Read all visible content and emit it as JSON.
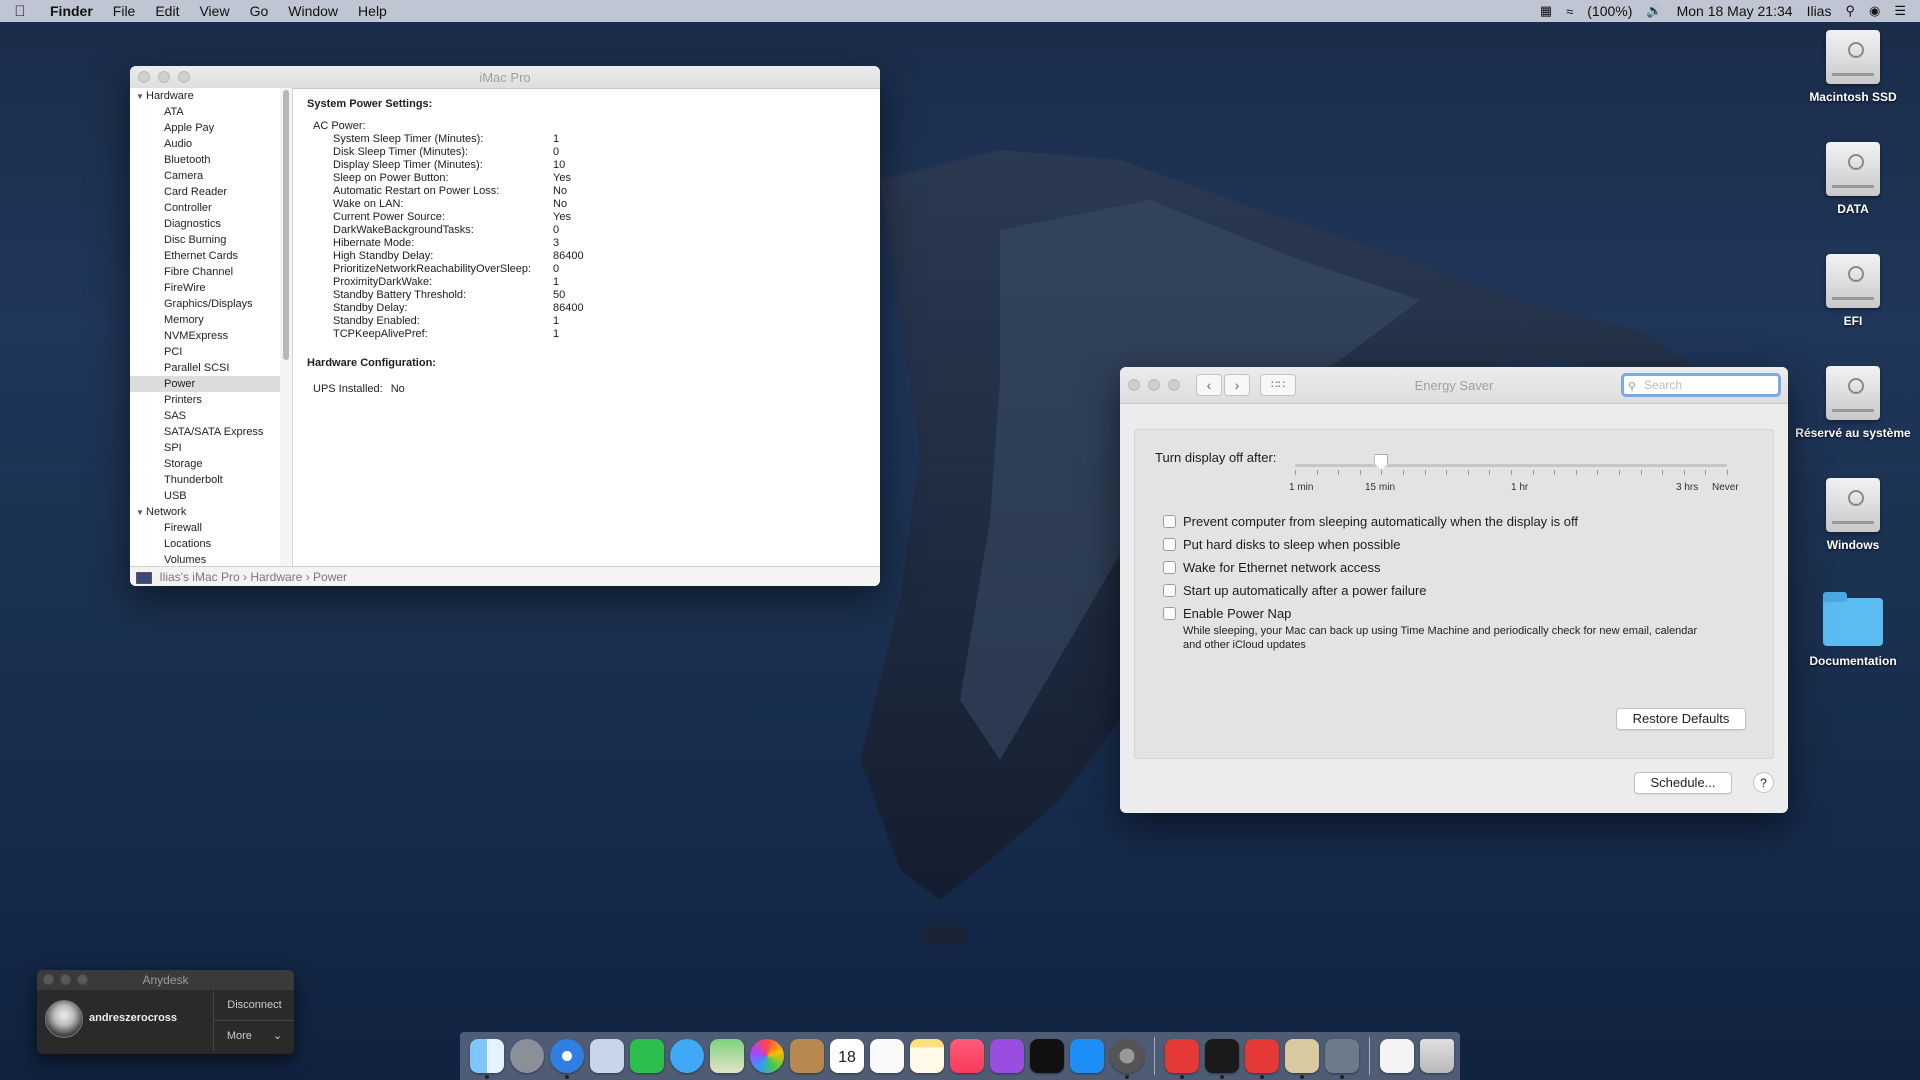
{
  "menubar": {
    "app": "Finder",
    "items": [
      "File",
      "Edit",
      "View",
      "Go",
      "Window",
      "Help"
    ],
    "battery": "(100%)",
    "datetime": "Mon 18 May  21:34",
    "user": "Ilias"
  },
  "sysinfo": {
    "title": "iMac Pro",
    "groups": [
      {
        "label": "Hardware",
        "items": [
          "ATA",
          "Apple Pay",
          "Audio",
          "Bluetooth",
          "Camera",
          "Card Reader",
          "Controller",
          "Diagnostics",
          "Disc Burning",
          "Ethernet Cards",
          "Fibre Channel",
          "FireWire",
          "Graphics/Displays",
          "Memory",
          "NVMExpress",
          "PCI",
          "Parallel SCSI",
          "Power",
          "Printers",
          "SAS",
          "SATA/SATA Express",
          "SPI",
          "Storage",
          "Thunderbolt",
          "USB"
        ]
      },
      {
        "label": "Network",
        "items": [
          "Firewall",
          "Locations",
          "Volumes"
        ]
      }
    ],
    "selected": "Power",
    "heading": "System Power Settings:",
    "ac_label": "AC Power:",
    "settings": [
      [
        "System Sleep Timer (Minutes):",
        "1"
      ],
      [
        "Disk Sleep Timer (Minutes):",
        "0"
      ],
      [
        "Display Sleep Timer (Minutes):",
        "10"
      ],
      [
        "Sleep on Power Button:",
        "Yes"
      ],
      [
        "Automatic Restart on Power Loss:",
        "No"
      ],
      [
        "Wake on LAN:",
        "No"
      ],
      [
        "Current Power Source:",
        "Yes"
      ],
      [
        "DarkWakeBackgroundTasks:",
        "0"
      ],
      [
        "Hibernate Mode:",
        "3"
      ],
      [
        "High Standby Delay:",
        "86400"
      ],
      [
        "PrioritizeNetworkReachabilityOverSleep:",
        "0"
      ],
      [
        "ProximityDarkWake:",
        "1"
      ],
      [
        "Standby Battery Threshold:",
        "50"
      ],
      [
        "Standby Delay:",
        "86400"
      ],
      [
        "Standby Enabled:",
        "1"
      ],
      [
        "TCPKeepAlivePref:",
        "1"
      ]
    ],
    "hw_heading": "Hardware Configuration:",
    "ups_label": "UPS Installed:",
    "ups_value": "No",
    "path": [
      "Ilias's iMac Pro",
      "Hardware",
      "Power"
    ]
  },
  "energy": {
    "title": "Energy Saver",
    "search_placeholder": "Search",
    "slider_label": "Turn display off after:",
    "slider_fraction": 0.2,
    "tick_labels": [
      "1 min",
      "15 min",
      "1 hr",
      "3 hrs",
      "Never"
    ],
    "options": [
      {
        "label": "Prevent computer from sleeping automatically when the display is off",
        "checked": false
      },
      {
        "label": "Put hard disks to sleep when possible",
        "checked": false
      },
      {
        "label": "Wake for Ethernet network access",
        "checked": false
      },
      {
        "label": "Start up automatically after a power failure",
        "checked": false
      },
      {
        "label": "Enable Power Nap",
        "checked": false
      }
    ],
    "power_nap_desc": "While sleeping, your Mac can back up using Time Machine and periodically check for new email, calendar and other iCloud updates",
    "restore_label": "Restore Defaults",
    "schedule_label": "Schedule...",
    "help_label": "?"
  },
  "desktop_icons": [
    "Macintosh SSD",
    "DATA",
    "EFI",
    "Réservé au système",
    "Windows",
    "Documentation"
  ],
  "anydesk": {
    "title": "Anydesk",
    "user": "andreszerocross",
    "disconnect": "Disconnect",
    "more": "More"
  },
  "dock": {
    "items": [
      "finder-icon",
      "launchpad-icon",
      "safari-icon",
      "preview-icon",
      "facetime-icon",
      "messages-icon",
      "maps-icon",
      "photos-icon",
      "contacts-icon",
      "calendar-icon",
      "reminders-icon",
      "notes-icon",
      "music-icon",
      "podcasts-icon",
      "tv-icon",
      "appstore-icon",
      "system-preferences-icon",
      "anydesk-icon",
      "terminal-icon",
      "anydesk2-icon",
      "preview2-icon",
      "xcode-icon",
      "document-icon",
      "trash-icon"
    ],
    "calendar_day": "18"
  }
}
